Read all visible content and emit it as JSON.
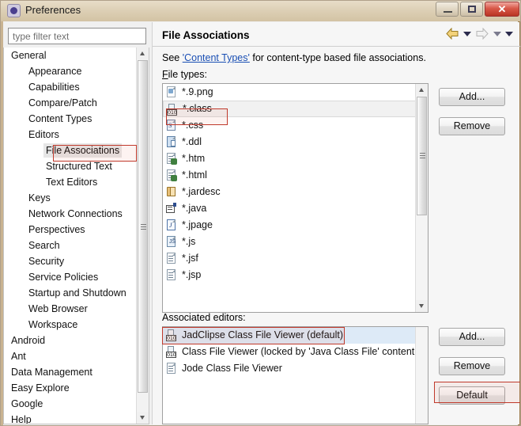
{
  "window": {
    "title": "Preferences",
    "icon": "preferences-icon",
    "minimize_label": "",
    "maximize_label": "",
    "close_label": "✕"
  },
  "sidebar": {
    "filter": {
      "placeholder": "type filter text",
      "value": ""
    },
    "items": [
      {
        "label": "General",
        "indent": 0,
        "selected": false
      },
      {
        "label": "Appearance",
        "indent": 1,
        "selected": false
      },
      {
        "label": "Capabilities",
        "indent": 1,
        "selected": false
      },
      {
        "label": "Compare/Patch",
        "indent": 1,
        "selected": false
      },
      {
        "label": "Content Types",
        "indent": 1,
        "selected": false
      },
      {
        "label": "Editors",
        "indent": 1,
        "selected": false
      },
      {
        "label": "File Associations",
        "indent": 2,
        "selected": true
      },
      {
        "label": "Structured Text",
        "indent": 2,
        "selected": false
      },
      {
        "label": "Text Editors",
        "indent": 2,
        "selected": false
      },
      {
        "label": "Keys",
        "indent": 1,
        "selected": false
      },
      {
        "label": "Network Connections",
        "indent": 1,
        "selected": false
      },
      {
        "label": "Perspectives",
        "indent": 1,
        "selected": false
      },
      {
        "label": "Search",
        "indent": 1,
        "selected": false
      },
      {
        "label": "Security",
        "indent": 1,
        "selected": false
      },
      {
        "label": "Service Policies",
        "indent": 1,
        "selected": false
      },
      {
        "label": "Startup and Shutdown",
        "indent": 1,
        "selected": false
      },
      {
        "label": "Web Browser",
        "indent": 1,
        "selected": false
      },
      {
        "label": "Workspace",
        "indent": 1,
        "selected": false
      },
      {
        "label": "Android",
        "indent": 0,
        "selected": false
      },
      {
        "label": "Ant",
        "indent": 0,
        "selected": false
      },
      {
        "label": "Data Management",
        "indent": 0,
        "selected": false
      },
      {
        "label": "Easy Explore",
        "indent": 0,
        "selected": false
      },
      {
        "label": "Google",
        "indent": 0,
        "selected": false
      },
      {
        "label": "Help",
        "indent": 0,
        "selected": false
      }
    ]
  },
  "page": {
    "title": "File Associations",
    "nav": {
      "back_icon": "back-arrow-icon",
      "back_dropdown_icon": "chevron-down-icon",
      "forward_icon": "forward-arrow-icon",
      "forward_dropdown_icon": "chevron-down-icon",
      "menu_icon": "chevron-down-icon"
    },
    "description_prefix": "See ",
    "description_link": "'Content Types'",
    "description_suffix": " for content-type based file associations.",
    "file_types_label": "File types:",
    "file_types": [
      {
        "name": "*.9.png",
        "icon": "image-file-icon",
        "selected": false
      },
      {
        "name": "*.class",
        "icon": "class-file-icon",
        "selected": true
      },
      {
        "name": "*.css",
        "icon": "css-file-icon",
        "selected": false
      },
      {
        "name": "*.ddl",
        "icon": "ddl-file-icon",
        "selected": false
      },
      {
        "name": "*.htm",
        "icon": "html-file-icon",
        "selected": false
      },
      {
        "name": "*.html",
        "icon": "html-file-icon",
        "selected": false
      },
      {
        "name": "*.jardesc",
        "icon": "jar-file-icon",
        "selected": false
      },
      {
        "name": "*.java",
        "icon": "java-file-icon",
        "selected": false
      },
      {
        "name": "*.jpage",
        "icon": "jpage-file-icon",
        "selected": false
      },
      {
        "name": "*.js",
        "icon": "js-file-icon",
        "selected": false
      },
      {
        "name": "*.jsf",
        "icon": "doc-file-icon",
        "selected": false
      },
      {
        "name": "*.jsp",
        "icon": "doc-file-icon",
        "selected": false
      }
    ],
    "file_types_buttons": {
      "add": "Add...",
      "remove": "Remove"
    },
    "associated_editors_label": "Associated editors:",
    "associated_editors": [
      {
        "name": "JadClipse Class File Viewer (default)",
        "icon": "class-file-icon",
        "selected": true
      },
      {
        "name": "Class File Viewer (locked by 'Java Class File' content type)",
        "icon": "class-file-icon",
        "selected": false
      },
      {
        "name": "Jode Class File Viewer",
        "icon": "doc-file-icon",
        "selected": false
      }
    ],
    "editors_buttons": {
      "add": "Add...",
      "remove": "Remove",
      "default": "Default"
    }
  },
  "annotations": [
    {
      "name": "sidebar-file-associations-highlight"
    },
    {
      "name": "class-filetype-highlight"
    },
    {
      "name": "jadclipse-editor-highlight"
    },
    {
      "name": "default-button-highlight"
    }
  ],
  "colors": {
    "titlebar": "#ddd0b6",
    "annotation": "#c0392b",
    "selection": "#ddeaf7",
    "link": "#1a4fb4"
  }
}
